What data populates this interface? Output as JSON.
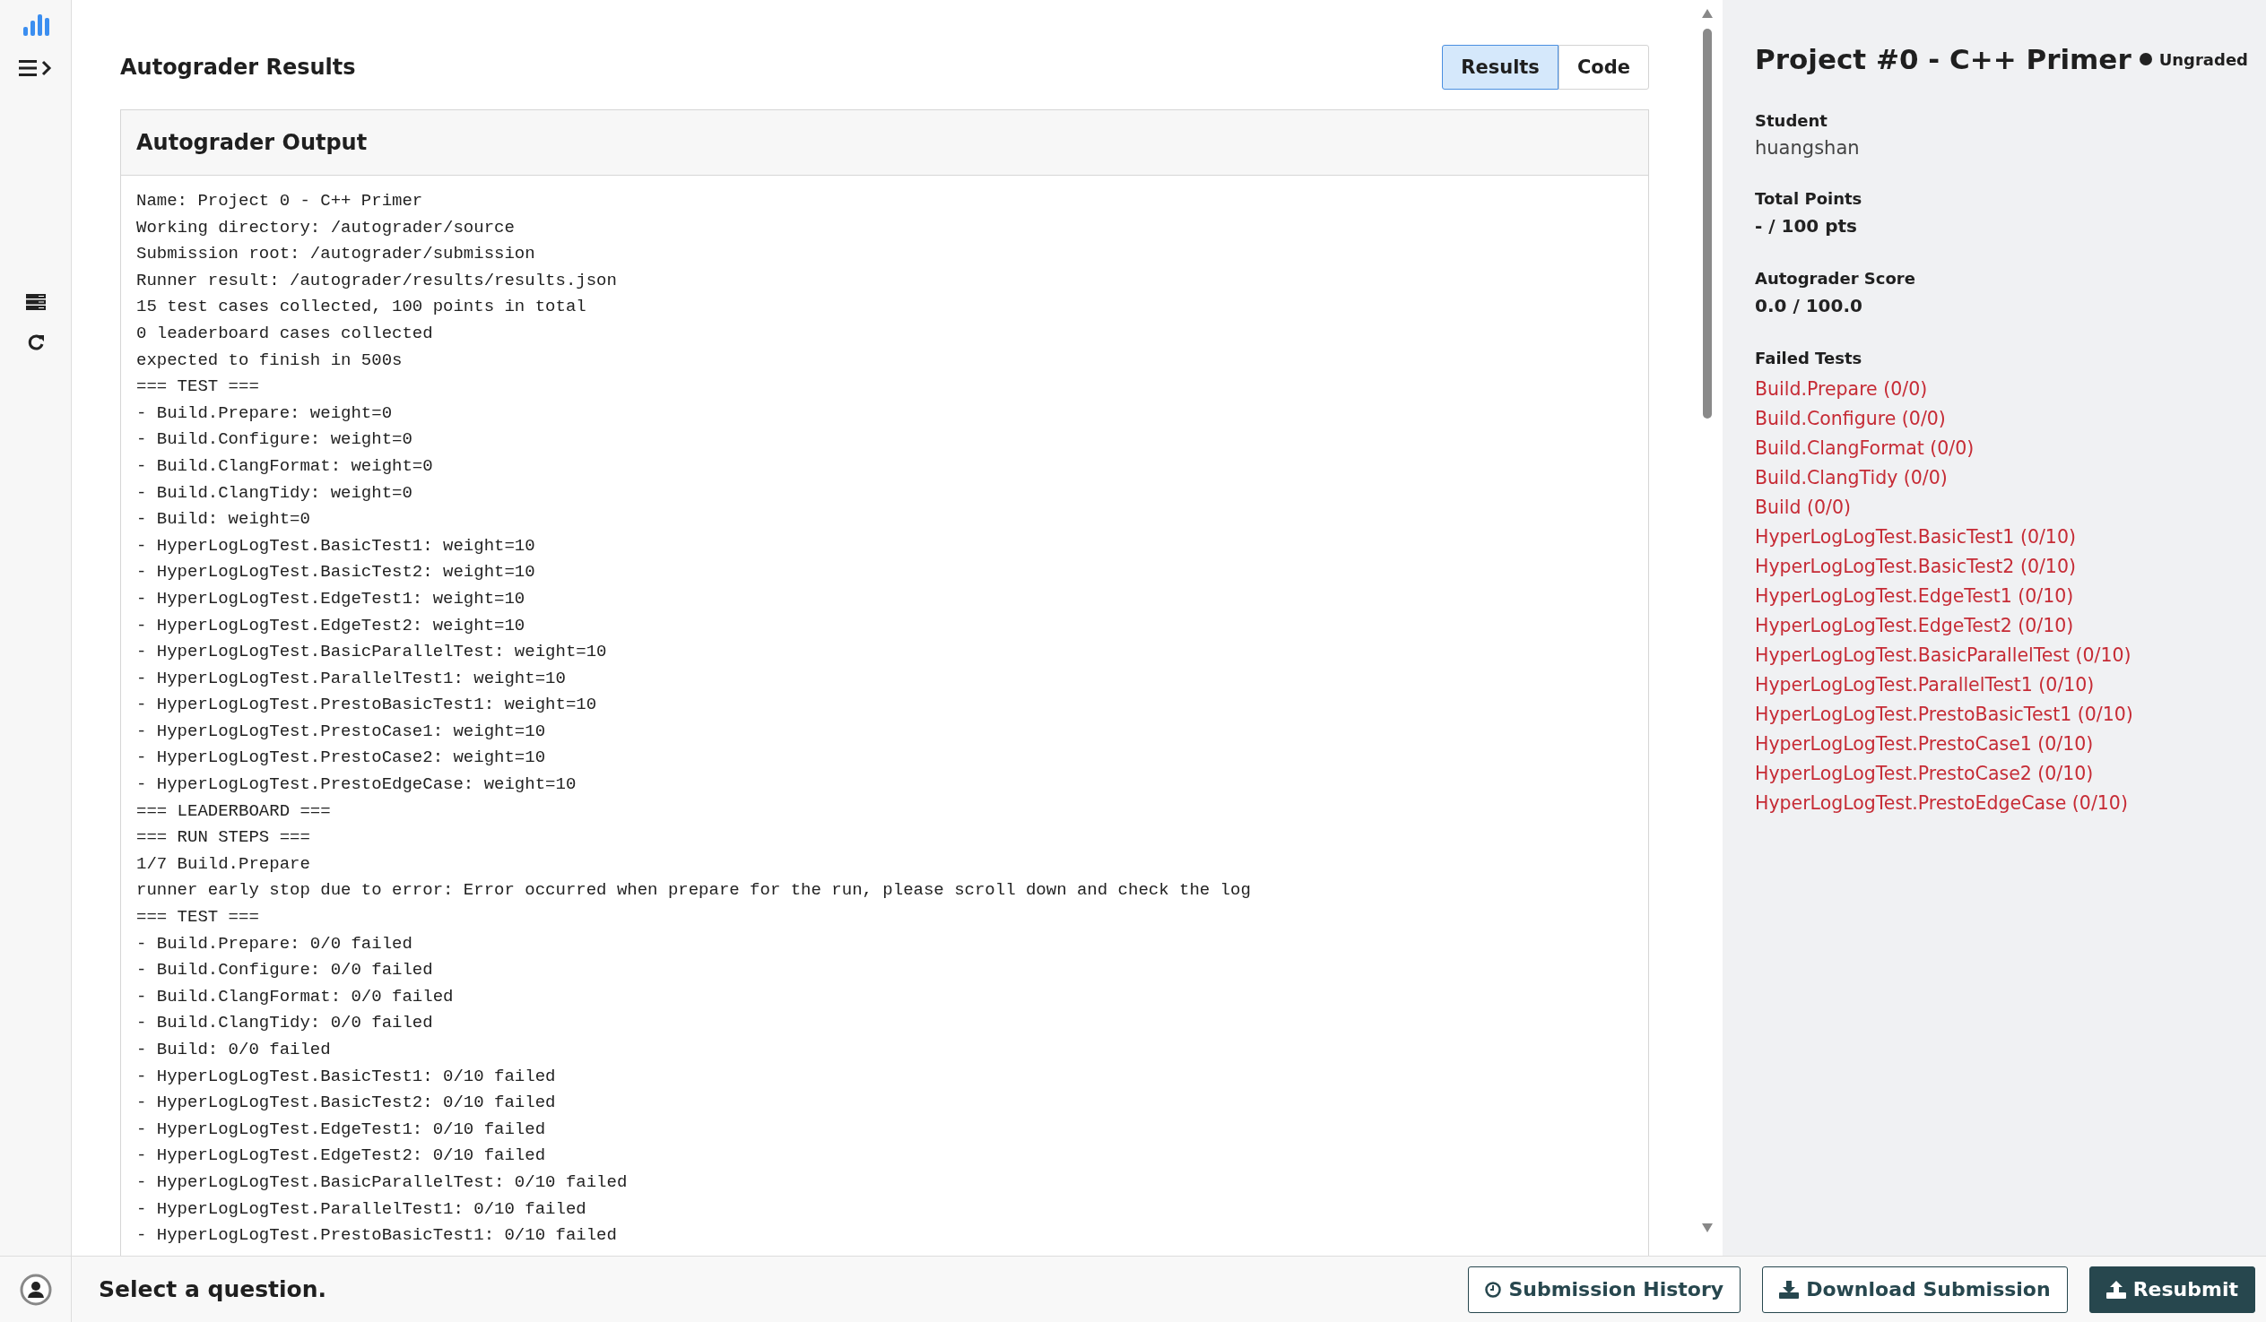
{
  "sidebar": {
    "items": [
      {
        "kind": "chart"
      },
      {
        "kind": "menu"
      },
      {
        "kind": "list"
      },
      {
        "kind": "refresh"
      }
    ]
  },
  "main": {
    "title": "Autograder Results",
    "tabs": [
      {
        "label": "Results",
        "selected": true
      },
      {
        "label": "Code",
        "selected": false
      }
    ],
    "output": {
      "title": "Autograder Output",
      "lines": [
        "Name: Project 0 - C++ Primer",
        "Working directory: /autograder/source",
        "Submission root: /autograder/submission",
        "Runner result: /autograder/results/results.json",
        "15 test cases collected, 100 points in total",
        "0 leaderboard cases collected",
        "expected to finish in 500s",
        "=== TEST ===",
        "- Build.Prepare: weight=0",
        "- Build.Configure: weight=0",
        "- Build.ClangFormat: weight=0",
        "- Build.ClangTidy: weight=0",
        "- Build: weight=0",
        "- HyperLogLogTest.BasicTest1: weight=10",
        "- HyperLogLogTest.BasicTest2: weight=10",
        "- HyperLogLogTest.EdgeTest1: weight=10",
        "- HyperLogLogTest.EdgeTest2: weight=10",
        "- HyperLogLogTest.BasicParallelTest: weight=10",
        "- HyperLogLogTest.ParallelTest1: weight=10",
        "- HyperLogLogTest.PrestoBasicTest1: weight=10",
        "- HyperLogLogTest.PrestoCase1: weight=10",
        "- HyperLogLogTest.PrestoCase2: weight=10",
        "- HyperLogLogTest.PrestoEdgeCase: weight=10",
        "=== LEADERBOARD ===",
        "=== RUN STEPS ===",
        "1/7 Build.Prepare",
        "runner early stop due to error: Error occurred when prepare for the run, please scroll down and check the log",
        "=== TEST ===",
        "- Build.Prepare: 0/0 failed",
        "- Build.Configure: 0/0 failed",
        "- Build.ClangFormat: 0/0 failed",
        "- Build.ClangTidy: 0/0 failed",
        "- Build: 0/0 failed",
        "- HyperLogLogTest.BasicTest1: 0/10 failed",
        "- HyperLogLogTest.BasicTest2: 0/10 failed",
        "- HyperLogLogTest.EdgeTest1: 0/10 failed",
        "- HyperLogLogTest.EdgeTest2: 0/10 failed",
        "- HyperLogLogTest.BasicParallelTest: 0/10 failed",
        "- HyperLogLogTest.ParallelTest1: 0/10 failed",
        "- HyperLogLogTest.PrestoBasicTest1: 0/10 failed"
      ]
    }
  },
  "details": {
    "title": "Project #0 - C++ Primer",
    "status": "Ungraded",
    "fields": [
      {
        "label": "Student",
        "value": "huangshan",
        "kind": "plain"
      },
      {
        "label": "Total Points",
        "value": "- / 100 pts",
        "kind": "bold"
      },
      {
        "label": "Autograder Score",
        "value": "0.0 / 100.0",
        "kind": "bold"
      }
    ],
    "failed_tests": {
      "label": "Failed Tests",
      "items": [
        "Build.Prepare (0/0)",
        "Build.Configure (0/0)",
        "Build.ClangFormat (0/0)",
        "Build.ClangTidy (0/0)",
        "Build (0/0)",
        "HyperLogLogTest.BasicTest1 (0/10)",
        "HyperLogLogTest.BasicTest2 (0/10)",
        "HyperLogLogTest.EdgeTest1 (0/10)",
        "HyperLogLogTest.EdgeTest2 (0/10)",
        "HyperLogLogTest.BasicParallelTest (0/10)",
        "HyperLogLogTest.ParallelTest1 (0/10)",
        "HyperLogLogTest.PrestoBasicTest1 (0/10)",
        "HyperLogLogTest.PrestoCase1 (0/10)",
        "HyperLogLogTest.PrestoCase2 (0/10)",
        "HyperLogLogTest.PrestoEdgeCase (0/10)"
      ]
    }
  },
  "footer": {
    "message": "Select a question.",
    "buttons": [
      {
        "label": "Submission History",
        "kind": "history"
      },
      {
        "label": "Download Submission",
        "kind": "download"
      },
      {
        "label": "Resubmit",
        "kind": "upload"
      }
    ]
  }
}
